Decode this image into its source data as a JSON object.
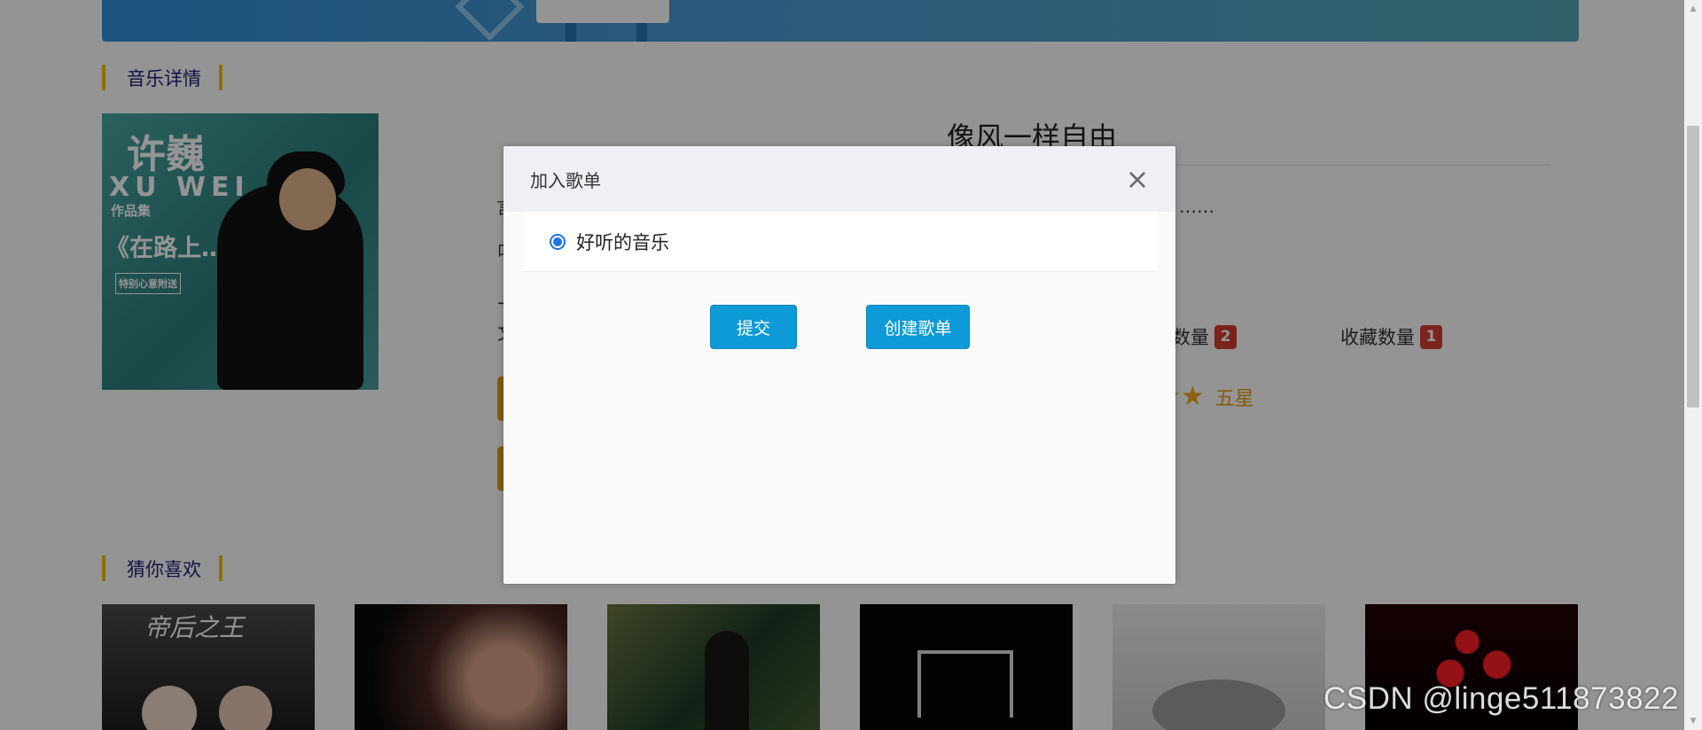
{
  "background": {
    "section_titles": {
      "music_detail": "音乐详情",
      "recommendations": "猜你喜欢"
    },
    "album": {
      "artist_cn": "许巍",
      "artist_en": "XU WEI",
      "collection": "作品集",
      "subtitle": "《在路上……》",
      "label": "特别心意附送"
    },
    "song": {
      "title": "像风一样自由",
      "snippets": {
        "s1": "言",
        "s2": "叫",
        "s3": "一",
        "s4": "文",
        "ellipsis": "……"
      },
      "stats": {
        "play_label": "数量",
        "play_count": "2",
        "favorite_label": "收藏数量",
        "favorite_count": "1"
      },
      "rating": {
        "stars": "★★",
        "text": "五星"
      }
    },
    "thumbnails": {
      "first_text": "帝后之王"
    }
  },
  "modal": {
    "title": "加入歌单",
    "close_symbol": "×",
    "playlists": [
      {
        "label": "好听的音乐",
        "selected": true
      }
    ],
    "buttons": {
      "submit": "提交",
      "create_playlist": "创建歌单"
    }
  },
  "watermark": "CSDN @linge511873822",
  "colors": {
    "accent_gold": "#f2c20d",
    "primary_blue": "#0e9ad6",
    "badge_red": "#d53d32",
    "rating_orange": "#e69b14",
    "radio_blue": "#1e73e8"
  },
  "icons": {
    "close": "close-icon",
    "radio": "radio-selected-icon",
    "star": "star-icon"
  }
}
